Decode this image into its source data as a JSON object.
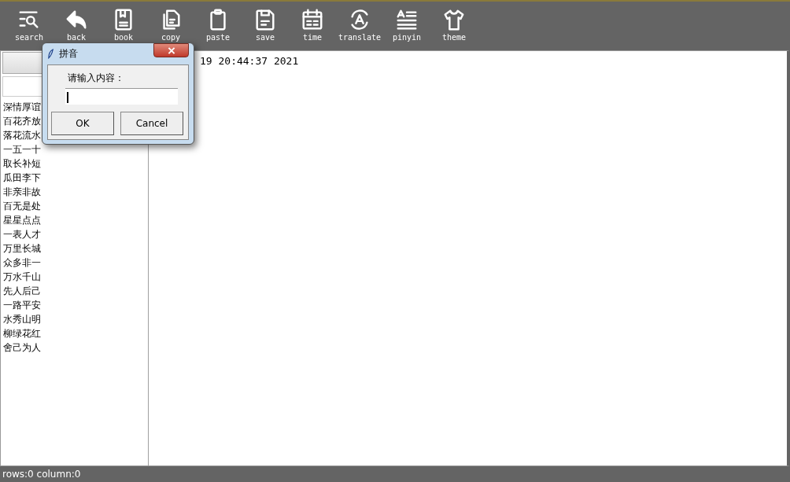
{
  "toolbar": [
    {
      "kind": "search",
      "label": "search"
    },
    {
      "kind": "back",
      "label": "back"
    },
    {
      "kind": "book",
      "label": "book"
    },
    {
      "kind": "copy",
      "label": "copy"
    },
    {
      "kind": "paste",
      "label": "paste"
    },
    {
      "kind": "save",
      "label": "save"
    },
    {
      "kind": "time",
      "label": "time"
    },
    {
      "kind": "translate",
      "label": "translate"
    },
    {
      "kind": "pinyin",
      "label": "pinyin"
    },
    {
      "kind": "theme",
      "label": "theme"
    }
  ],
  "sidebar": {
    "items": [
      "深情厚谊",
      "百花齐放",
      "落花流水",
      "一五一十",
      "取长补短",
      "瓜田李下",
      "非亲非故",
      "百无是处",
      "星星点点",
      "一表人才",
      "万里长城",
      "众多非一",
      "万水千山",
      "先人后己",
      "一路平安",
      "水秀山明",
      "柳绿花红",
      "舍己为人"
    ]
  },
  "editor": {
    "text": "19 20:44:37 2021"
  },
  "dialog": {
    "title": "拼音",
    "prompt": "请输入内容：",
    "buttons": [
      "OK",
      "Cancel"
    ]
  },
  "status_bar": "rows:0 column:0"
}
